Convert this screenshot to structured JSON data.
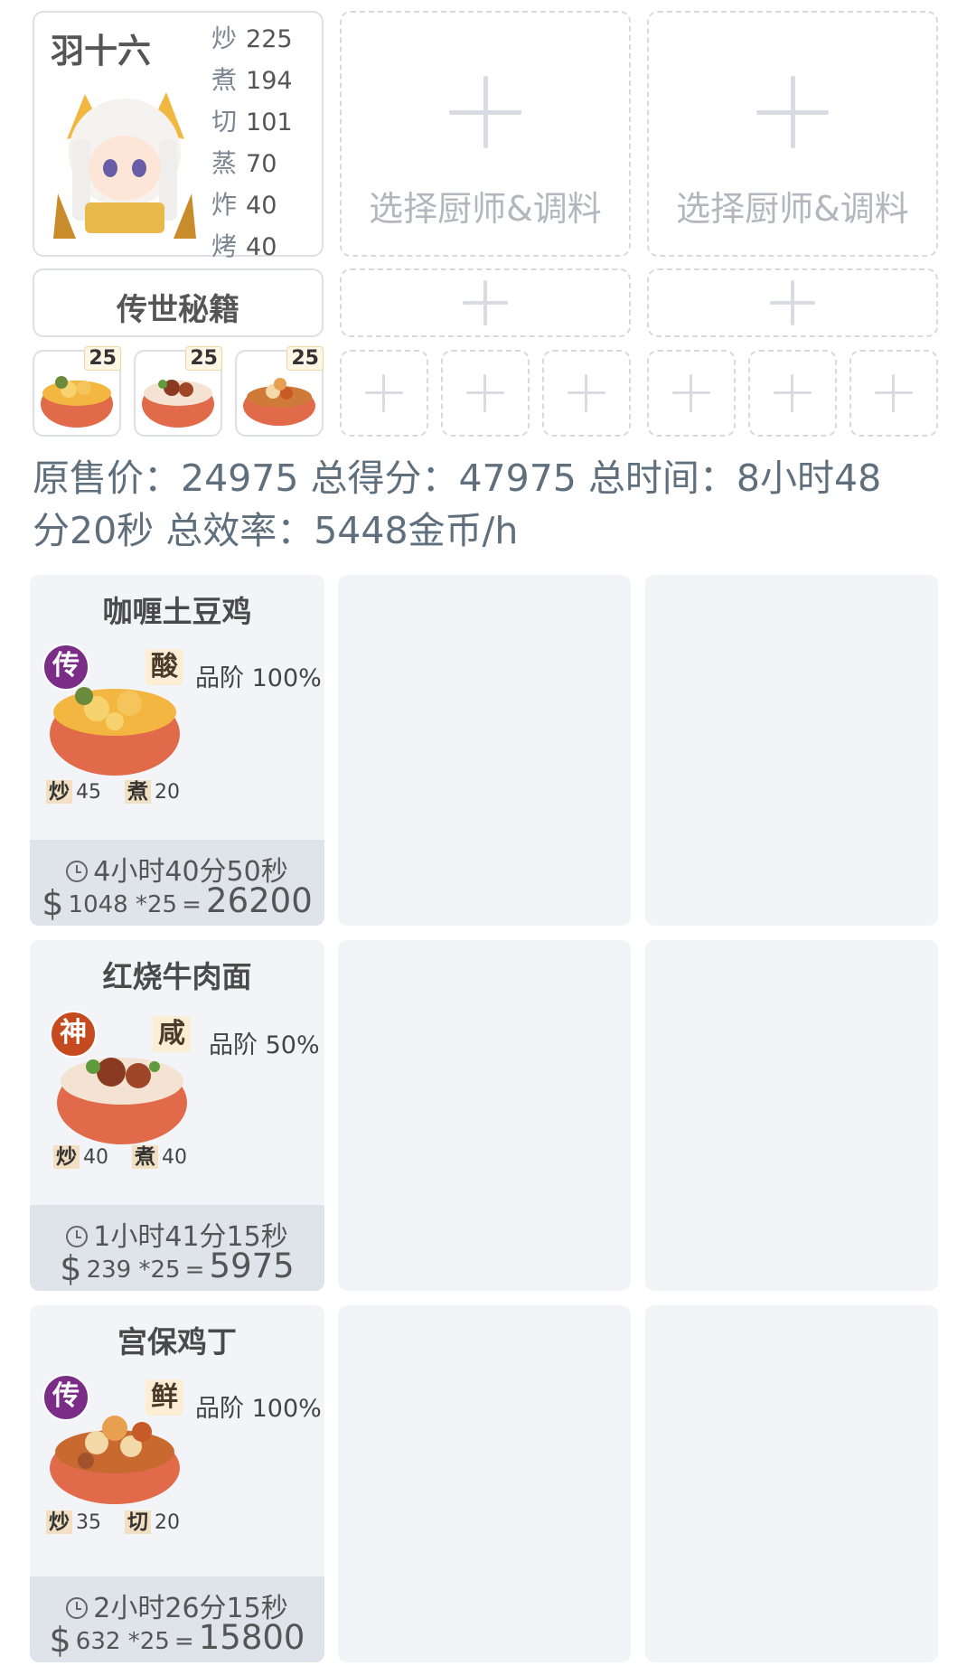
{
  "chef": {
    "name": "羽十六",
    "skills": [
      {
        "label": "炒",
        "value": "225"
      },
      {
        "label": "煮",
        "value": "194"
      },
      {
        "label": "切",
        "value": "101"
      },
      {
        "label": "蒸",
        "value": "70"
      },
      {
        "label": "炸",
        "value": "40"
      },
      {
        "label": "烤",
        "value": "40"
      }
    ],
    "equip_label": "传世秘籍"
  },
  "empty_slot_label": "选择厨师&调料",
  "recipe_slots": [
    {
      "count": "25",
      "icon": "curry-chicken-bowl"
    },
    {
      "count": "25",
      "icon": "beef-noodle-bowl"
    },
    {
      "count": "25",
      "icon": "kungpao-chicken-bowl"
    }
  ],
  "summary": {
    "line1": "原售价：24975 总得分：47975 总时间：8小时48",
    "line2": "分20秒 总效率：5448金币/h"
  },
  "recipes": [
    {
      "name": "咖喱土豆鸡",
      "grade": "传",
      "grade_color": "#7a2c86",
      "taste": "酸",
      "quality": "品阶 100%",
      "req": [
        {
          "k": "炒",
          "v": "45"
        },
        {
          "k": "煮",
          "v": "20"
        }
      ],
      "time": "4小时40分50秒",
      "price": "1048 *25",
      "eq": "=",
      "total": "26200"
    },
    {
      "name": "红烧牛肉面",
      "grade": "神",
      "grade_color": "#c64a20",
      "taste": "咸",
      "quality": "品阶 50%",
      "req": [
        {
          "k": "炒",
          "v": "40"
        },
        {
          "k": "煮",
          "v": "40"
        }
      ],
      "time": "1小时41分15秒",
      "price": "239 *25",
      "eq": "=",
      "total": "5975"
    },
    {
      "name": "宫保鸡丁",
      "grade": "传",
      "grade_color": "#7a2c86",
      "taste": "鲜",
      "quality": "品阶 100%",
      "req": [
        {
          "k": "炒",
          "v": "35"
        },
        {
          "k": "切",
          "v": "20"
        }
      ],
      "time": "2小时26分15秒",
      "price": "632 *25",
      "eq": "=",
      "total": "15800"
    }
  ]
}
